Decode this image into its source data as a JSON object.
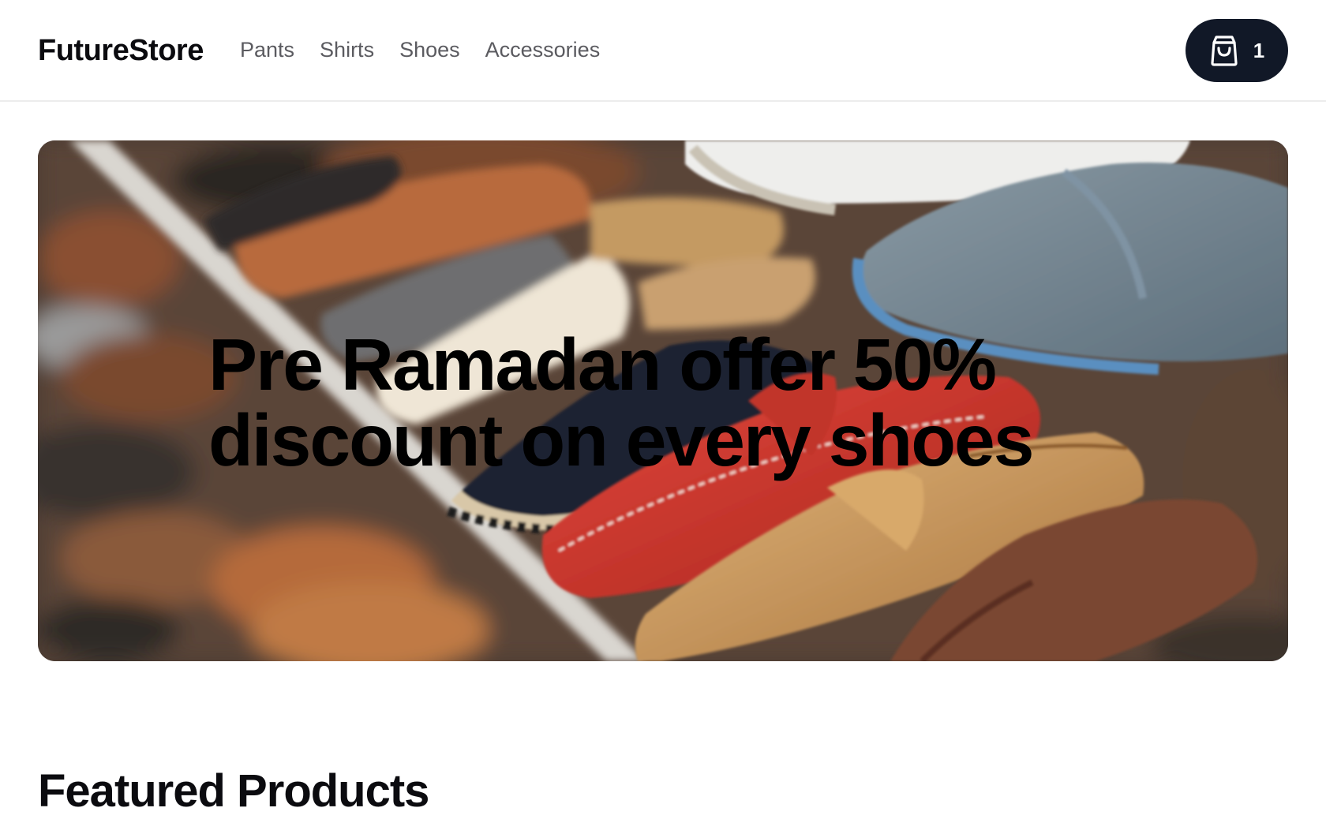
{
  "header": {
    "logo": "FutureStore",
    "nav": [
      "Pants",
      "Shirts",
      "Shoes",
      "Accessories"
    ],
    "cart": {
      "icon": "shopping-bag-icon",
      "count": "1",
      "bg_color": "#111827"
    }
  },
  "hero": {
    "image": "shoe-rack-photo",
    "title": "Pre Ramadan offer 50% discount on every shoes"
  },
  "featured": {
    "title": "Featured Products"
  }
}
